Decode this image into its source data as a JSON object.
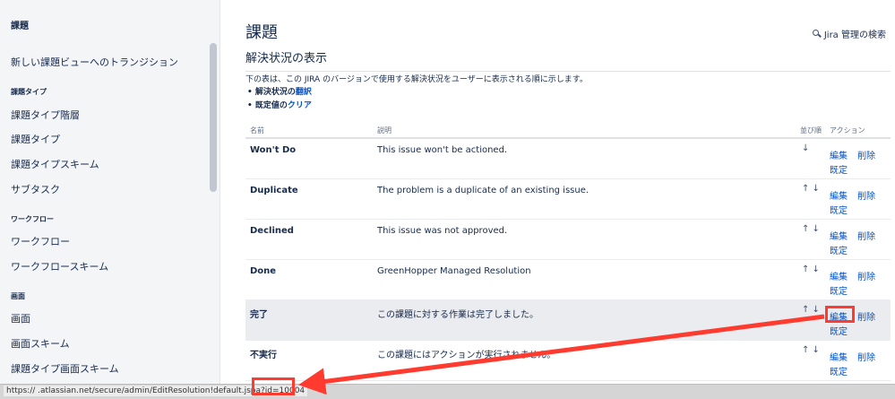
{
  "sidebar": {
    "title": "課題",
    "link_transition": "新しい課題ビューへのトランジション",
    "head_issue_types": "課題タイプ",
    "link_type_hierarchy": "課題タイプ階層",
    "link_issue_types": "課題タイプ",
    "link_type_scheme": "課題タイプスキーム",
    "link_subtask": "サブタスク",
    "head_workflow": "ワークフロー",
    "link_workflow": "ワークフロー",
    "link_workflow_scheme": "ワークフロースキーム",
    "head_screens": "画面",
    "link_screens": "画面",
    "link_screen_scheme": "画面スキーム",
    "link_type_screen_scheme": "課題タイプ画面スキーム"
  },
  "header": {
    "title": "課題",
    "search_label": "Jira 管理の検索",
    "search_icon": "search-icon"
  },
  "section": {
    "title": "解決状況の表示",
    "description": "下の表は、この JIRA のバージョンで使用する解決状況をユーザーに表示される順に示します。",
    "bullet1_prefix": "解決状況の",
    "bullet1_link": "翻訳",
    "bullet2_prefix": "既定値の",
    "bullet2_link": "クリア"
  },
  "table": {
    "headers": {
      "name": "名前",
      "description": "説明",
      "order": "並び順",
      "actions": "アクション"
    },
    "actions": {
      "edit": "編集",
      "delete": "削除",
      "default": "既定"
    },
    "rows": [
      {
        "name": "Won't Do",
        "description": "This issue won't be actioned.",
        "arrows": "↓"
      },
      {
        "name": "Duplicate",
        "description": "The problem is a duplicate of an existing issue.",
        "arrows": "↑ ↓"
      },
      {
        "name": "Declined",
        "description": "This issue was not approved.",
        "arrows": "↑ ↓"
      },
      {
        "name": "Done",
        "description": "GreenHopper Managed Resolution",
        "arrows": "↑ ↓"
      },
      {
        "name": "完了",
        "description": "この課題に対する作業は完了しました。",
        "arrows": "↑ ↓"
      },
      {
        "name": "不実行",
        "description": "この課題にはアクションが実行されません。",
        "arrows": "↑ ↓"
      }
    ]
  },
  "status_bar": {
    "url": "https://          .atlassian.net/secure/admin/EditResolution!default.jspa?id=10004"
  },
  "colors": {
    "link": "#0052cc",
    "annotation": "#ff3b30",
    "sidebar_bg": "#f4f5f7"
  }
}
